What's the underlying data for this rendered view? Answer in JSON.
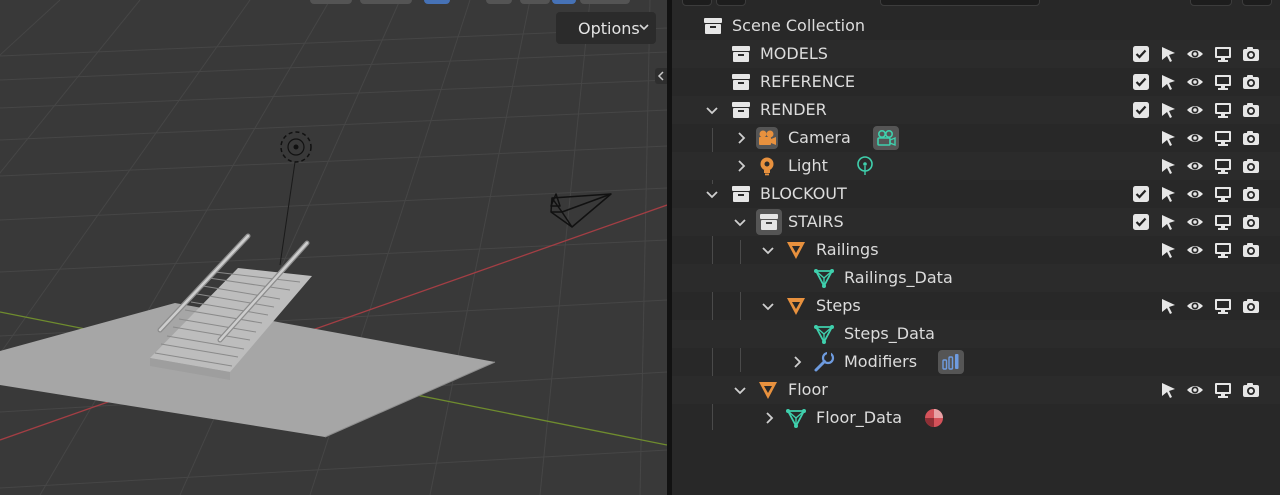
{
  "viewport": {
    "options_label": "Options"
  },
  "outliner": {
    "rows": [
      {
        "label": "Scene Collection"
      },
      {
        "label": "MODELS"
      },
      {
        "label": "REFERENCE"
      },
      {
        "label": "RENDER"
      },
      {
        "label": "Camera"
      },
      {
        "label": "Light"
      },
      {
        "label": "BLOCKOUT"
      },
      {
        "label": "STAIRS"
      },
      {
        "label": "Railings"
      },
      {
        "label": "Railings_Data"
      },
      {
        "label": "Steps"
      },
      {
        "label": "Steps_Data"
      },
      {
        "label": "Modifiers"
      },
      {
        "label": "Floor"
      },
      {
        "label": "Floor_Data"
      }
    ]
  },
  "colors": {
    "viewport_bg": "#393939",
    "outliner_bg": "#282828",
    "object_orange": "#e8913e",
    "mesh_data_teal": "#3fd0ad",
    "modifier_blue": "#6e9bdf",
    "material_red": "#d4525a",
    "axis_red": "#a33e44",
    "axis_green": "#6f8c2e"
  }
}
